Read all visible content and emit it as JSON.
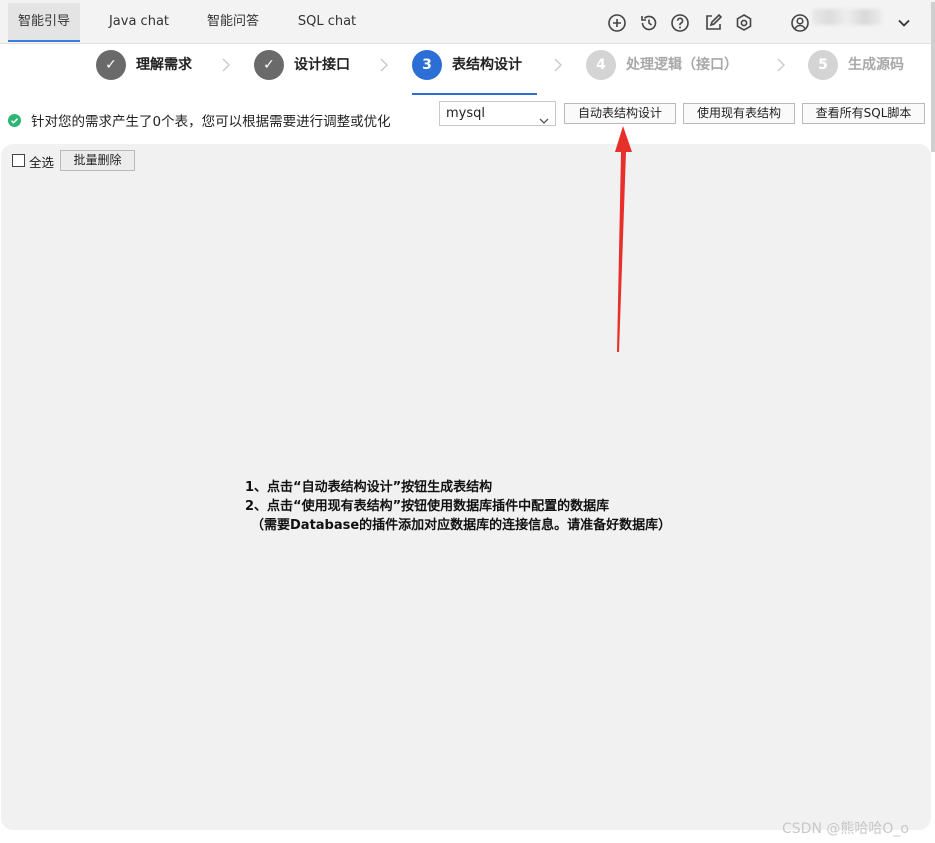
{
  "tabs": [
    {
      "label": "智能引导",
      "active": true
    },
    {
      "label": "Java chat",
      "active": false
    },
    {
      "label": "智能问答",
      "active": false
    },
    {
      "label": "SQL chat",
      "active": false
    }
  ],
  "top_icons": [
    "add-circle-icon",
    "history-icon",
    "help-icon",
    "edit-icon",
    "settings-icon",
    "user-icon"
  ],
  "steps": [
    {
      "num": "✓",
      "label": "理解需求",
      "state": "done"
    },
    {
      "num": "✓",
      "label": "设计接口",
      "state": "done"
    },
    {
      "num": "3",
      "label": "表结构设计",
      "state": "current"
    },
    {
      "num": "4",
      "label": "处理逻辑（接口）",
      "state": "todo"
    },
    {
      "num": "5",
      "label": "生成源码",
      "state": "todo"
    }
  ],
  "status": {
    "text": "针对您的需求产生了0个表，您可以根据需要进行调整或优化",
    "color": "#2bb673"
  },
  "db_select": {
    "value": "mysql"
  },
  "buttons": {
    "auto_design": "自动表结构设计",
    "use_existing": "使用现有表结构",
    "view_sql": "查看所有SQL脚本",
    "select_all": "全选",
    "batch_delete": "批量删除"
  },
  "instructions": [
    "1、点击“自动表结构设计”按钮生成表结构",
    "2、点击“使用现有表结构”按钮使用数据库插件中配置的数据库",
    "（需要Database的插件添加对应数据库的连接信息。请准备好数据库）"
  ],
  "watermark": "CSDN @熊哈哈O_o",
  "colors": {
    "accent": "#2b6fd6",
    "arrow": "#e8302a"
  }
}
